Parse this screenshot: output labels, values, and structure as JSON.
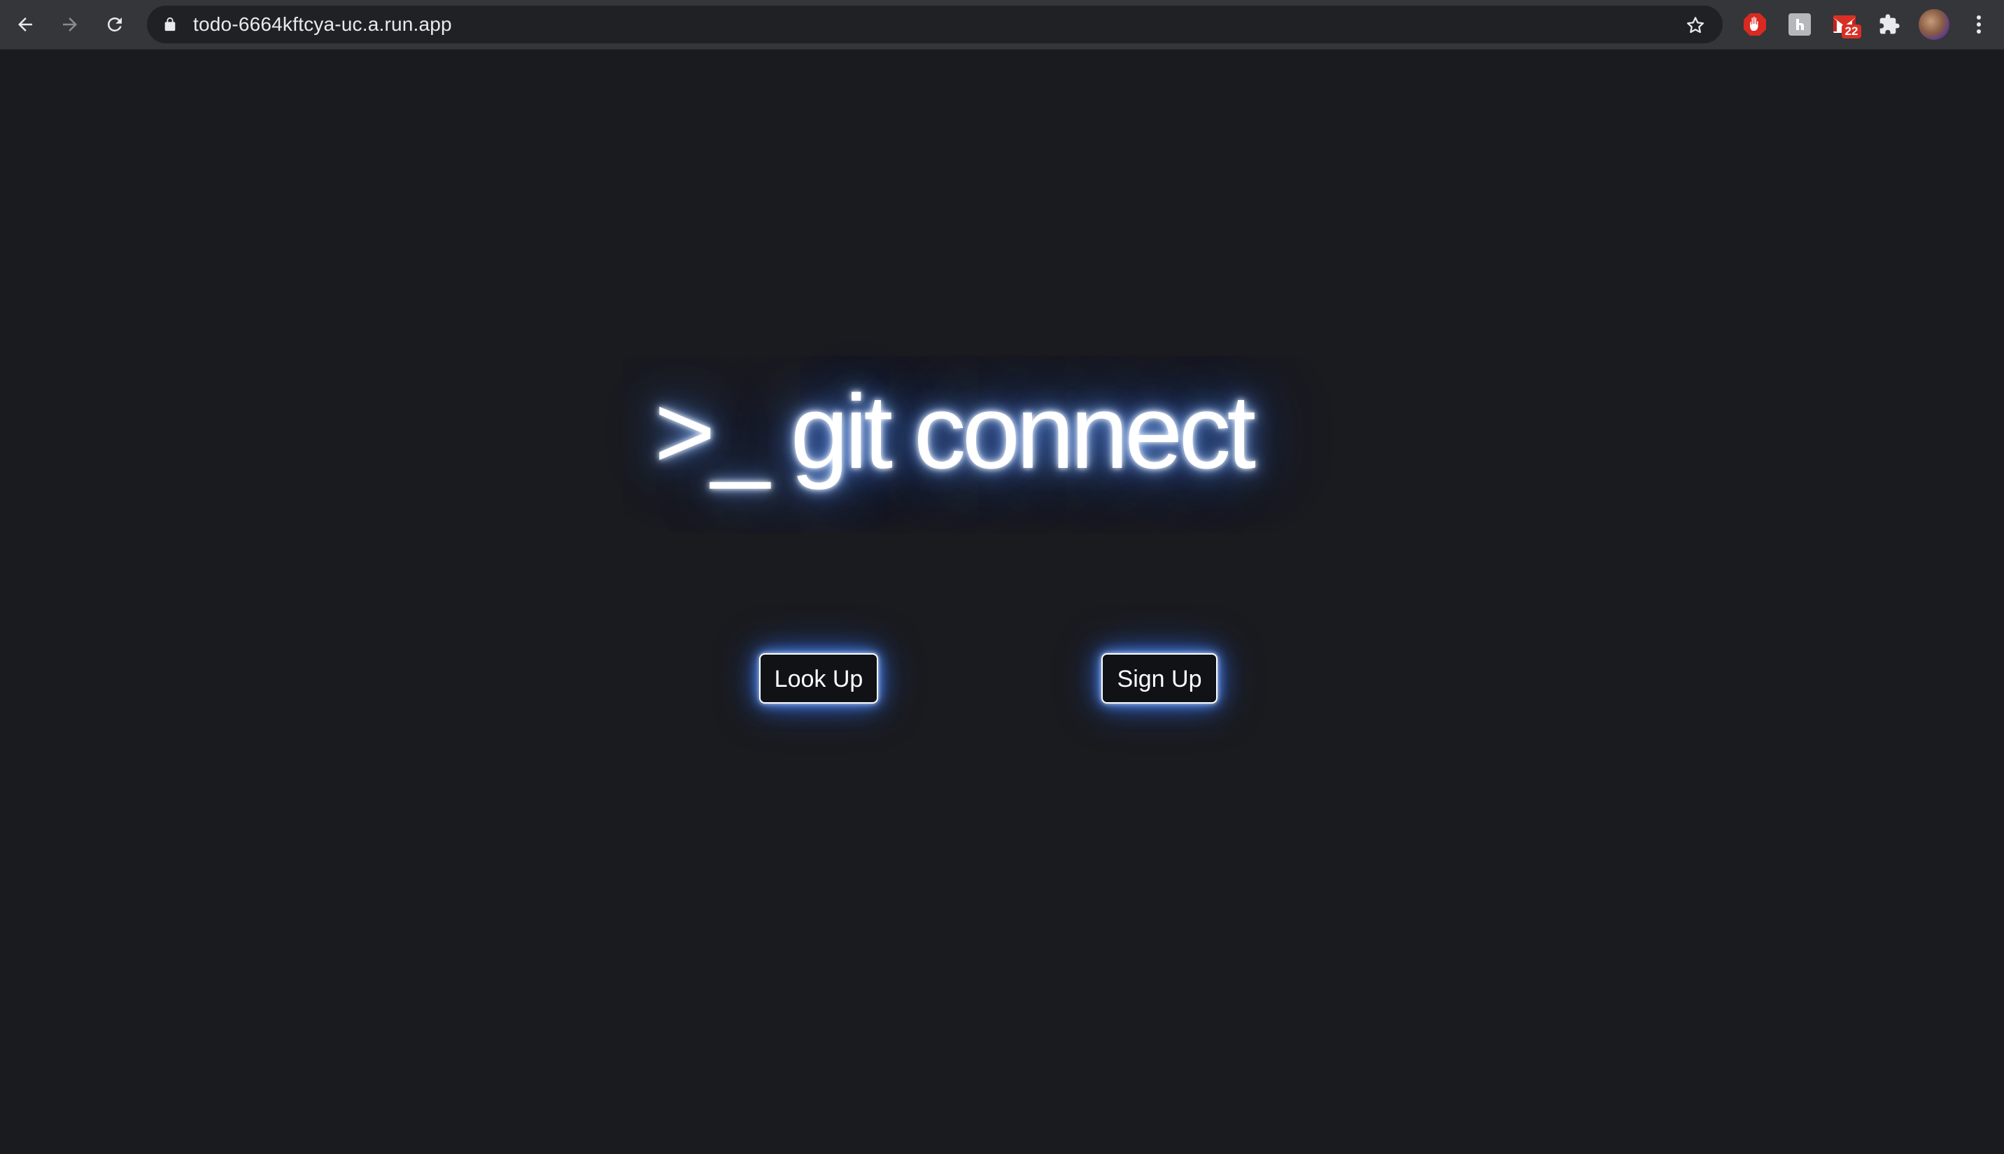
{
  "browser": {
    "url": "todo-6664kftcya-uc.a.run.app",
    "icons": {
      "back": "back-arrow-icon",
      "forward": "forward-arrow-icon",
      "reload": "reload-icon",
      "lock": "lock-icon",
      "bookmark": "star-icon",
      "extensions": [
        "stop-hand-extension-icon",
        "grey-square-extension-icon",
        "mail-extension-icon",
        "puzzle-piece-icon"
      ],
      "profile": "avatar",
      "menu": "kebab-menu-icon"
    },
    "mail_badge": "22",
    "colors": {
      "toolbar": "#35363a",
      "omnibox": "#202124",
      "badge": "#d93025"
    }
  },
  "page": {
    "title": ">_ git connect",
    "buttons": {
      "look_up": "Look Up",
      "sign_up": "Sign Up"
    },
    "colors": {
      "background": "#1a1b1f",
      "glow": "#3c78ff",
      "text": "#ffffff"
    }
  }
}
